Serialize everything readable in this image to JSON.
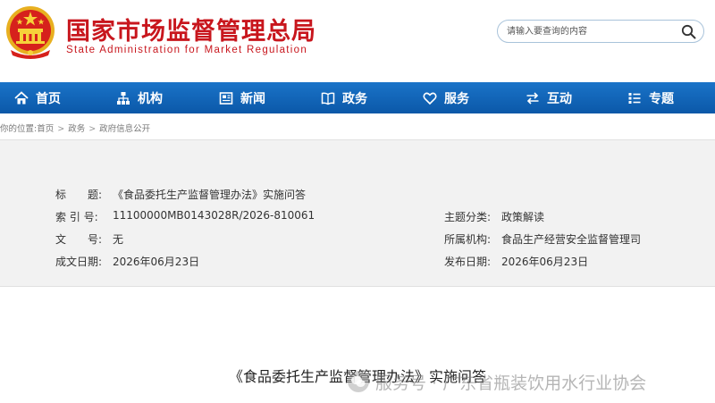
{
  "header": {
    "title_cn": "国家市场监督管理总局",
    "title_en": "State Administration for Market Regulation",
    "emblem_icon": "national-emblem-icon"
  },
  "search": {
    "placeholder": "请输入要查询的内容",
    "icon": "search-icon"
  },
  "nav": {
    "items": [
      {
        "label": "首页",
        "icon": "home-icon"
      },
      {
        "label": "机构",
        "icon": "org-chart-icon"
      },
      {
        "label": "新闻",
        "icon": "news-icon"
      },
      {
        "label": "政务",
        "icon": "book-icon"
      },
      {
        "label": "服务",
        "icon": "heart-icon"
      },
      {
        "label": "互动",
        "icon": "exchange-icon"
      },
      {
        "label": "专题",
        "icon": "list-icon"
      }
    ]
  },
  "breadcrumb": {
    "prefix": "你的位置:",
    "items": [
      "首页",
      "政务",
      "政府信息公开"
    ],
    "separator": ">"
  },
  "info": {
    "title_label": "标　　题:",
    "title_value": "《食品委托生产监督管理办法》实施问答",
    "index_label": "索 引 号:",
    "index_value": "11100000MB0143028R/2026-810061",
    "docno_label": "文　　号:",
    "docno_value": "无",
    "date_label": "成文日期:",
    "date_value": "2026年06月23日",
    "category_label": "主题分类:",
    "category_value": "政策解读",
    "org_label": "所属机构:",
    "org_value": "食品生产经营安全监督管理司",
    "pubdate_label": "发布日期:",
    "pubdate_value": "2026年06月23日"
  },
  "document": {
    "title": "《食品委托生产监督管理办法》实施问答"
  },
  "watermark": {
    "text": "服务号 · 广东省瓶装饮用水行业协会"
  },
  "colors": {
    "brand_red": "#c8161d",
    "nav_blue": "#0b58a8",
    "info_bg": "#f2f2f2"
  }
}
